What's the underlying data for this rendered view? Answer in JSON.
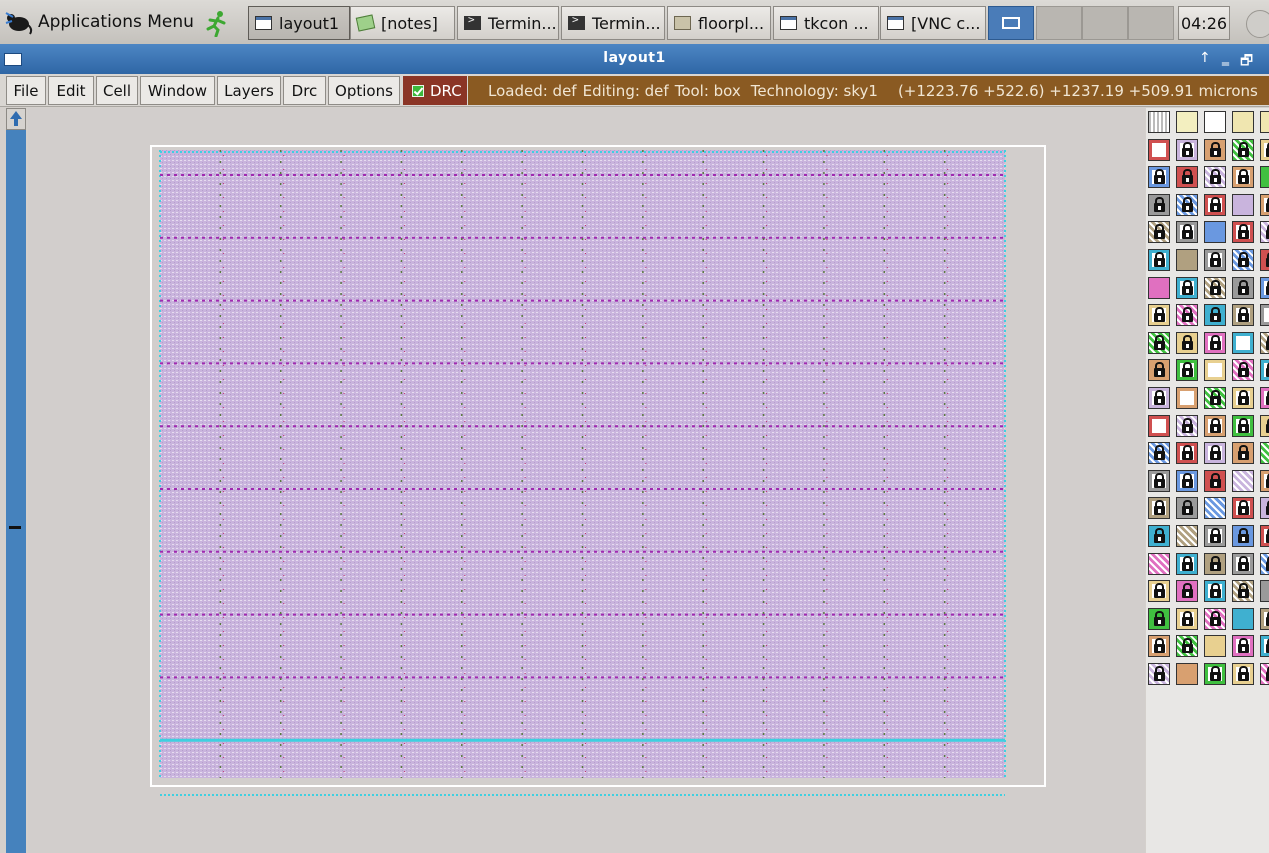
{
  "taskbar": {
    "apps_menu_label": "Applications Menu",
    "tasks": [
      {
        "label": "layout1",
        "icon": "window-icon",
        "active": true
      },
      {
        "label": "[notes]",
        "icon": "notes-icon",
        "active": false
      },
      {
        "label": "Termin...",
        "icon": "terminal-icon",
        "active": false
      },
      {
        "label": "Termin...",
        "icon": "terminal-icon",
        "active": false
      },
      {
        "label": "floorpl...",
        "icon": "folder-icon",
        "active": false
      },
      {
        "label": "tkcon ...",
        "icon": "window-icon",
        "active": false
      },
      {
        "label": "[VNC c...",
        "icon": "window-icon",
        "active": false
      }
    ],
    "clock": "04:26"
  },
  "window": {
    "title": "layout1",
    "controls": {
      "up": "↑",
      "minimize": "‗",
      "restore": "🗗"
    }
  },
  "menubar": {
    "items": [
      "File",
      "Edit",
      "Cell",
      "Window",
      "Layers",
      "Drc",
      "Options"
    ],
    "drc_label": "DRC",
    "drc_checked": true
  },
  "status": {
    "loaded": "Loaded: def",
    "editing": "Editing: def",
    "tool": "Tool: box",
    "technology": "Technology: sky1",
    "coordinates": "(+1223.76 +522.6) +1237.19 +509.91 microns"
  },
  "colors": {
    "titlebar": "#3a72b3",
    "drc_toggle": "#8b3526",
    "status_bar": "#8a5a22",
    "layout_fill": "#c8b3dc",
    "rail_magenta": "#a02ab0",
    "boundary": "#ffffff",
    "power_cyan": "#3fd0e0"
  },
  "layout": {
    "row_count": 10,
    "column_count": 14,
    "highlight_row": 9
  },
  "palette": {
    "rows": 21,
    "columns": 5
  }
}
